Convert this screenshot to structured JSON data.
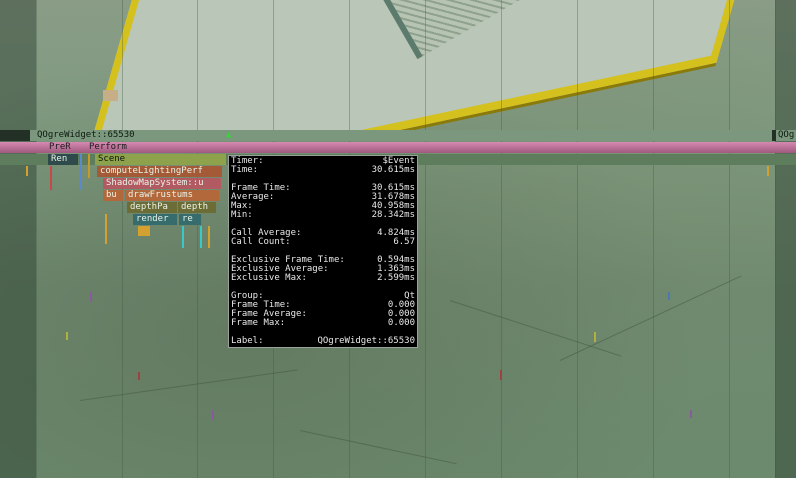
{
  "profiler": {
    "widget_label_left": "QOgreWidget::65530",
    "widget_label_right": "QOg",
    "blocks": {
      "prer": "PreR",
      "perform": "Perform",
      "ren": "Ren",
      "scene": "Scene",
      "compute_lighting": "computeLightingPerf",
      "shadow_map": "ShadowMapSystem::u",
      "bu": "bu",
      "draw_frustums": "drawFrustums",
      "depth_pa": "depthPa",
      "depth": "depth",
      "render": "render",
      "re": "re"
    }
  },
  "tooltip": {
    "timer_label": "Timer:",
    "timer_value": "$Event",
    "time_label": "Time:",
    "time_value": "30.615ms",
    "frame_time_label": "Frame Time:",
    "frame_time_value": "30.615ms",
    "average_label": "Average:",
    "average_value": "31.678ms",
    "max_label": "Max:",
    "max_value": "40.958ms",
    "min_label": "Min:",
    "min_value": "28.342ms",
    "call_average_label": "Call Average:",
    "call_average_value": "4.824ms",
    "call_count_label": "Call Count:",
    "call_count_value": "6.57",
    "excl_frame_time_label": "Exclusive Frame Time:",
    "excl_frame_time_value": "0.594ms",
    "excl_average_label": "Exclusive Average:",
    "excl_average_value": "1.363ms",
    "excl_max_label": "Exclusive Max:",
    "excl_max_value": "2.599ms",
    "group_label": "Group:",
    "group_value": "Qt",
    "group_frame_time_label": "Frame Time:",
    "group_frame_time_value": "0.000",
    "group_frame_average_label": "Frame Average:",
    "group_frame_average_value": "0.000",
    "group_frame_max_label": "Frame Max:",
    "group_frame_max_value": "0.000",
    "label_label": "Label:",
    "label_value": "QOgreWidget::65530"
  },
  "colors": {
    "tooltip_bg": "#000000",
    "pink_bar": "#d789b2",
    "slab_border": "#d4c11e"
  }
}
